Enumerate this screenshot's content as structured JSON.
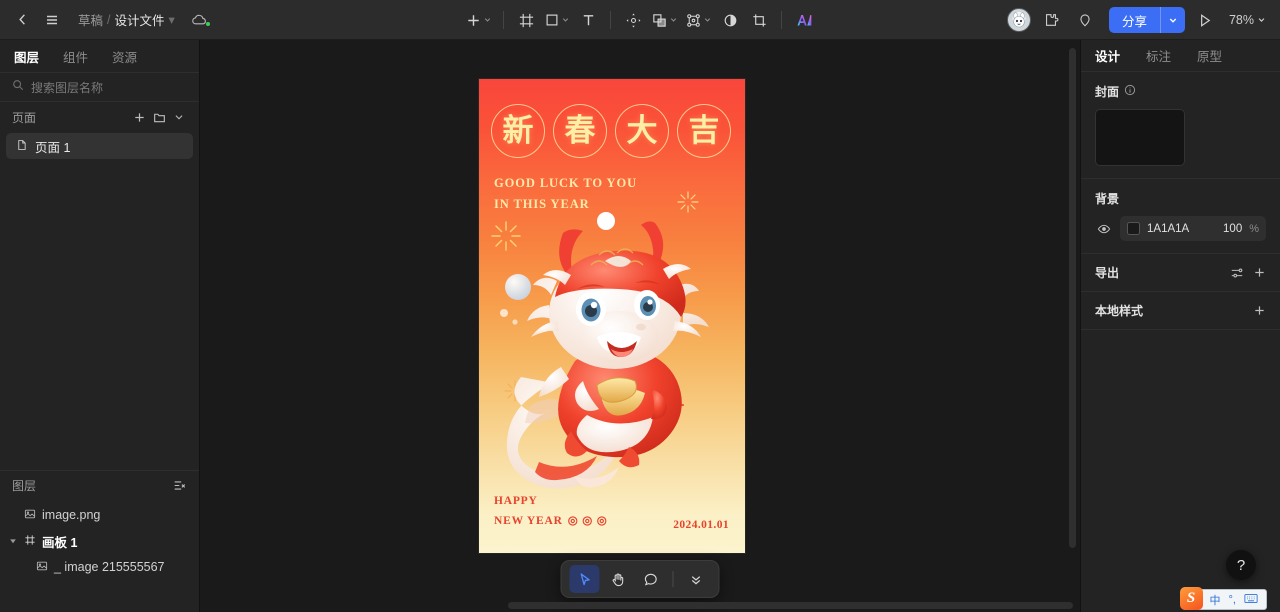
{
  "topbar": {
    "back_icon": "chevron-left-icon",
    "menu_icon": "hamburger-menu-icon",
    "breadcrumb": {
      "root": "草稿",
      "separator": "/",
      "current": "设计文件",
      "chevron": "▾"
    },
    "cloud_icon": "cloud-sync-icon",
    "tools": [
      {
        "name": "add-tool",
        "icon": "plus-icon",
        "has_chevron": true
      },
      {
        "name": "frame-tool",
        "icon": "frame-icon",
        "has_chevron": false
      },
      {
        "name": "shape-tool",
        "icon": "rectangle-icon",
        "has_chevron": true
      },
      {
        "name": "text-tool",
        "icon": "text-icon",
        "has_chevron": false
      },
      {
        "name": "transform-tool",
        "icon": "move-transform-icon",
        "has_chevron": false
      },
      {
        "name": "boolean-tool",
        "icon": "boolean-union-icon",
        "has_chevron": true
      },
      {
        "name": "pen-tool",
        "icon": "vector-node-icon",
        "has_chevron": true
      },
      {
        "name": "mask-tool",
        "icon": "contrast-circle-icon",
        "has_chevron": false
      },
      {
        "name": "slice-tool",
        "icon": "crop-slice-icon",
        "has_chevron": false
      },
      {
        "name": "ai-tool",
        "icon": "ai-sparkle-icon",
        "has_chevron": false
      }
    ],
    "avatar": "user-avatar-rabbit",
    "plugin_icon": "plugin-puzzle-icon",
    "comment_icon": "comment-pin-icon",
    "share_label": "分享",
    "share_chevron": "▾",
    "present_icon": "play-present-icon",
    "zoom_level": "78%",
    "zoom_chevron": "▾",
    "accent_color": "#3b6ef5"
  },
  "left_panel": {
    "tabs": [
      {
        "label": "图层",
        "active": true
      },
      {
        "label": "组件",
        "active": false
      },
      {
        "label": "资源",
        "active": false
      }
    ],
    "search_placeholder": "搜索图层名称",
    "pages_section": {
      "title": "页面",
      "add_icon": "plus-icon",
      "folder_icon": "folder-icon",
      "collapse_icon": "chevron-down-icon",
      "items": [
        {
          "label": "页面 1",
          "icon": "page-file-icon",
          "selected": true
        }
      ]
    },
    "layers_section": {
      "title": "图层",
      "filter_icon": "layer-filter-icon",
      "items": [
        {
          "label": "image.png",
          "icon": "image-icon",
          "depth": 0,
          "expandable": false,
          "bold": false
        },
        {
          "label": "画板 1",
          "icon": "frame-icon",
          "depth": 0,
          "expandable": true,
          "bold": true
        },
        {
          "label": "_ image 215555567",
          "icon": "image-icon",
          "depth": 1,
          "expandable": false,
          "bold": false
        }
      ]
    }
  },
  "canvas": {
    "background_color": "#1A1A1A",
    "artboard": {
      "glyph_circles": [
        "新",
        "春",
        "大",
        "吉"
      ],
      "english_lines": [
        "GOOD LUCK TO YOU",
        "IN THIS YEAR"
      ],
      "bottom_lines": [
        "HAPPY",
        "NEW YEAR"
      ],
      "bottom_marks": "◎ ◎ ◎",
      "date": "2024.01.01",
      "artwork": "dragon-mascot-illustration",
      "gradient_top": "#F9463C",
      "gradient_bottom": "#FCF4CD",
      "text_gold": "#FFE9A8",
      "text_red": "#E8432D"
    },
    "float_toolbar": [
      {
        "name": "select-tool",
        "icon": "cursor-arrow-icon",
        "active": true
      },
      {
        "name": "hand-tool",
        "icon": "hand-pan-icon",
        "active": false
      },
      {
        "name": "comment-tool",
        "icon": "comment-bubble-icon",
        "active": false
      },
      {
        "name": "collapse-toolbar",
        "icon": "chevrons-down-icon",
        "active": false
      }
    ],
    "vscrollbar": "vertical-scrollbar",
    "hscrollbar": "horizontal-scrollbar"
  },
  "right_panel": {
    "tabs": [
      {
        "label": "设计",
        "active": true
      },
      {
        "label": "标注",
        "active": false
      },
      {
        "label": "原型",
        "active": false
      }
    ],
    "cover": {
      "title": "封面",
      "info_icon": "info-icon"
    },
    "background": {
      "title": "背景",
      "eye_icon": "eye-visible-icon",
      "color_hex": "1A1A1A",
      "swatch_color": "#1A1A1A",
      "opacity": "100",
      "opacity_unit": "%"
    },
    "export": {
      "title": "导出",
      "settings_icon": "sliders-icon",
      "add_icon": "plus-icon"
    },
    "local_styles": {
      "title": "本地样式",
      "add_icon": "plus-icon"
    }
  },
  "overlay": {
    "help_label": "?",
    "ime": {
      "logo": "S",
      "mode": "中",
      "punctuation": "°,",
      "keyboard_icon": "keyboard-icon"
    }
  }
}
